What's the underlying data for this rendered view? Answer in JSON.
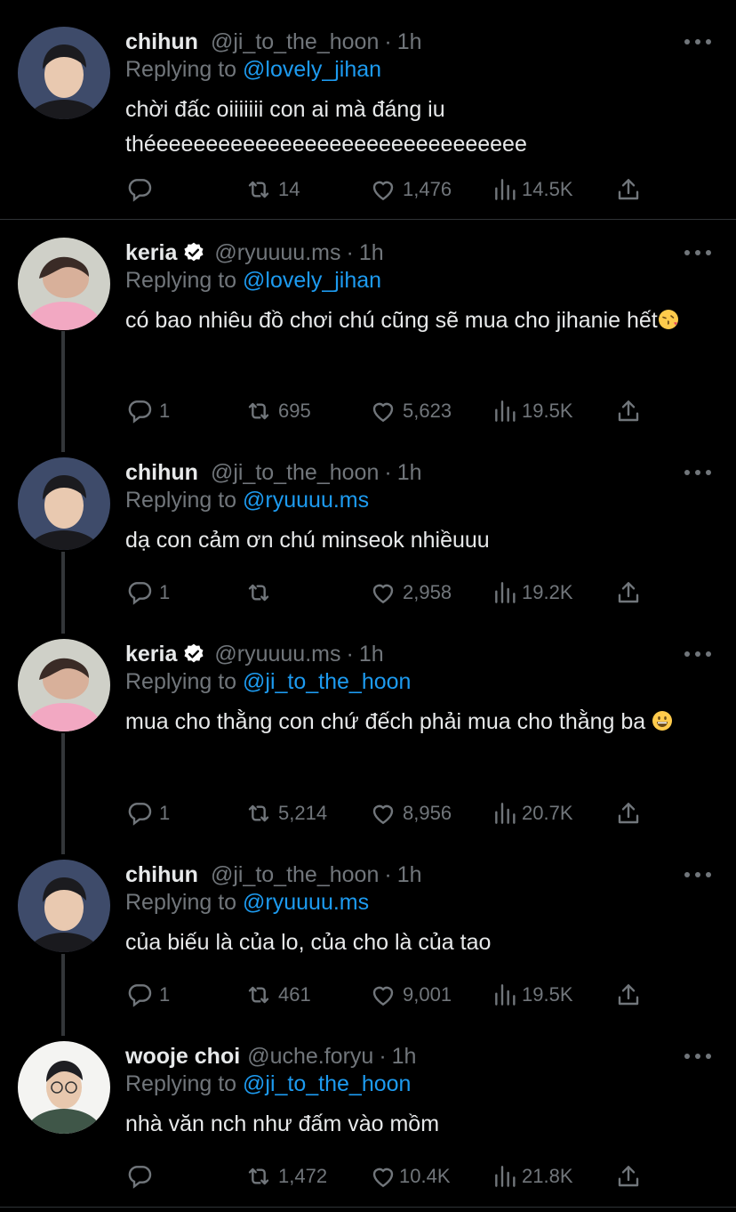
{
  "colors": {
    "background": "#000000",
    "text": "#e7e9ea",
    "muted": "#71767b",
    "accent": "#1d9bf0",
    "verified": "#ffffff"
  },
  "tweets": [
    {
      "name": "chihun",
      "handle": "@ji_to_the_hoon",
      "sep": "·",
      "time": "1h",
      "replying_label": "Replying to",
      "replying_to": "@lovely_jihan",
      "text": "chời đấc oiiiiiii con ai mà đáng iu théeeeeeeeeeeeeeeeeeeeeeeeeeeeeee",
      "verified": false,
      "counts": {
        "reply": "",
        "retweet": "14",
        "like": "1,476",
        "views": "14.5K"
      }
    },
    {
      "name": "keria",
      "handle": "@ryuuuu.ms",
      "sep": "·",
      "time": "1h",
      "replying_label": "Replying to",
      "replying_to": "@lovely_jihan",
      "text": "có bao nhiêu đồ chơi chú cũng sẽ mua cho jihanie hết",
      "emoji": "face-blowing-kiss",
      "verified": true,
      "counts": {
        "reply": "1",
        "retweet": "695",
        "like": "5,623",
        "views": "19.5K"
      }
    },
    {
      "name": "chihun",
      "handle": "@ji_to_the_hoon",
      "sep": "·",
      "time": "1h",
      "replying_label": "Replying to",
      "replying_to": "@ryuuuu.ms",
      "text": "dạ con cảm ơn chú minseok nhiềuuu",
      "verified": false,
      "counts": {
        "reply": "1",
        "retweet": "",
        "like": "2,958",
        "views": "19.2K"
      }
    },
    {
      "name": "keria",
      "handle": "@ryuuuu.ms",
      "sep": "·",
      "time": "1h",
      "replying_label": "Replying to",
      "replying_to": "@ji_to_the_hoon",
      "text": "mua cho thằng con chứ đếch phải mua cho thằng ba",
      "emoji": "grinning-face",
      "verified": true,
      "counts": {
        "reply": "1",
        "retweet": "5,214",
        "like": "8,956",
        "views": "20.7K"
      }
    },
    {
      "name": "chihun",
      "handle": "@ji_to_the_hoon",
      "sep": "·",
      "time": "1h",
      "replying_label": "Replying to",
      "replying_to": "@ryuuuu.ms",
      "text": "của biếu là của lo, của cho là của tao",
      "verified": false,
      "counts": {
        "reply": "1",
        "retweet": "461",
        "like": "9,001",
        "views": "19.5K"
      }
    },
    {
      "name": "wooje choi",
      "handle": "@uche.foryu",
      "sep": "·",
      "time": "1h",
      "replying_label": "Replying to",
      "replying_to": "@ji_to_the_hoon",
      "text": "nhà văn nch như đấm vào mồm",
      "verified": false,
      "counts": {
        "reply": "",
        "retweet": "1,472",
        "like": "10.4K",
        "views": "21.8K"
      }
    }
  ],
  "icons": [
    "reply-icon",
    "retweet-icon",
    "like-icon",
    "views-icon",
    "share-icon",
    "more-icon",
    "verified-badge-icon"
  ]
}
